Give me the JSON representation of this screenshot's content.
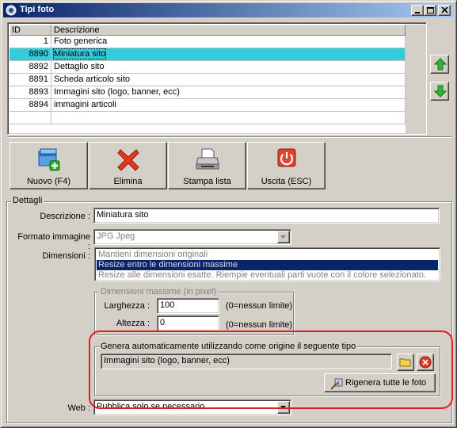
{
  "window": {
    "title": "Tipi foto",
    "controls": [
      "minimize",
      "maximize",
      "close"
    ]
  },
  "grid": {
    "columns": [
      "ID",
      "Descrizione"
    ],
    "rows": [
      {
        "id": "1",
        "descrizione": "Foto generica",
        "selected": false
      },
      {
        "id": "8890",
        "descrizione": "Miniatura sito",
        "selected": true
      },
      {
        "id": "8892",
        "descrizione": "Dettaglio sito",
        "selected": false
      },
      {
        "id": "8891",
        "descrizione": "Scheda articolo sito",
        "selected": false
      },
      {
        "id": "8893",
        "descrizione": "Immagini sito (logo, banner, ecc)",
        "selected": false
      },
      {
        "id": "8894",
        "descrizione": "immagini articoli",
        "selected": false
      }
    ],
    "move_up_icon": "green-up-arrow-icon",
    "move_down_icon": "green-down-arrow-icon"
  },
  "toolbar": {
    "new_label": "Nuovo (F4)",
    "delete_label": "Elimina",
    "print_label": "Stampa lista",
    "exit_label": "Uscita (ESC)"
  },
  "details": {
    "group_title": "Dettagli",
    "descrizione_label": "Descrizione :",
    "descrizione_value": "Miniatura sito",
    "formato_label": "Formato immagine :",
    "formato_value": "JPG Jpeg",
    "dimensioni_label": "Dimensioni :",
    "dimensioni_options": [
      "Mantieni dimensioni originali",
      "Resize entro le dimensioni massime",
      "Resize alle dimensioni esatte. Riempie eventuali parti vuote con il colore selezionato."
    ],
    "dimensioni_selected_index": 1,
    "max_group_title": "Dimensioni massime (in pixel)",
    "larghezza_label": "Larghezza :",
    "larghezza_value": "100",
    "larghezza_hint": "(0=nessun limite)",
    "altezza_label": "Altezza :",
    "altezza_value": "0",
    "altezza_hint": "(0=nessun limite)",
    "genera_group_title": "Genera automaticamente utilizzando come origine il seguente tipo",
    "genera_value": "Immagini sito (logo, banner, ecc)",
    "rigenera_label": "Rigenera tutte le foto",
    "web_label": "Web :",
    "web_value": "Pubblica solo se necessario"
  },
  "colors": {
    "title_start": "#0a246a",
    "title_end": "#a6caf0",
    "selected_row": "#33ccdd",
    "annotation_ring": "#e81c1c"
  }
}
